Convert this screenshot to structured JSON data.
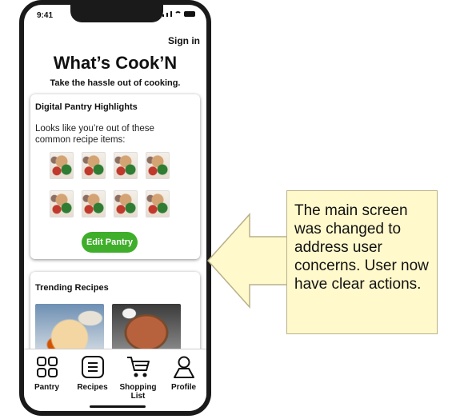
{
  "status_bar": {
    "time": "9:41"
  },
  "header": {
    "sign_in": "Sign in",
    "title": "What’s Cook’N",
    "subtitle": "Take the hassle out of cooking."
  },
  "pantry_card": {
    "title": "Digital Pantry Highlights",
    "text": "Looks like you’re out of these common recipe items:",
    "edit_button": "Edit Pantry"
  },
  "trending_card": {
    "title": "Trending Recipes"
  },
  "tabs": [
    {
      "label": "Pantry",
      "icon": "grid-icon"
    },
    {
      "label": "Recipes",
      "icon": "list-icon"
    },
    {
      "label": "Shopping List",
      "icon": "cart-icon"
    },
    {
      "label": "Profile",
      "icon": "person-icon"
    }
  ],
  "callout": {
    "text": "The main screen was changed to address user concerns. User now have clear actions.",
    "fill_color": "#fff9cc"
  },
  "colors": {
    "accent": "#3fae2a"
  }
}
